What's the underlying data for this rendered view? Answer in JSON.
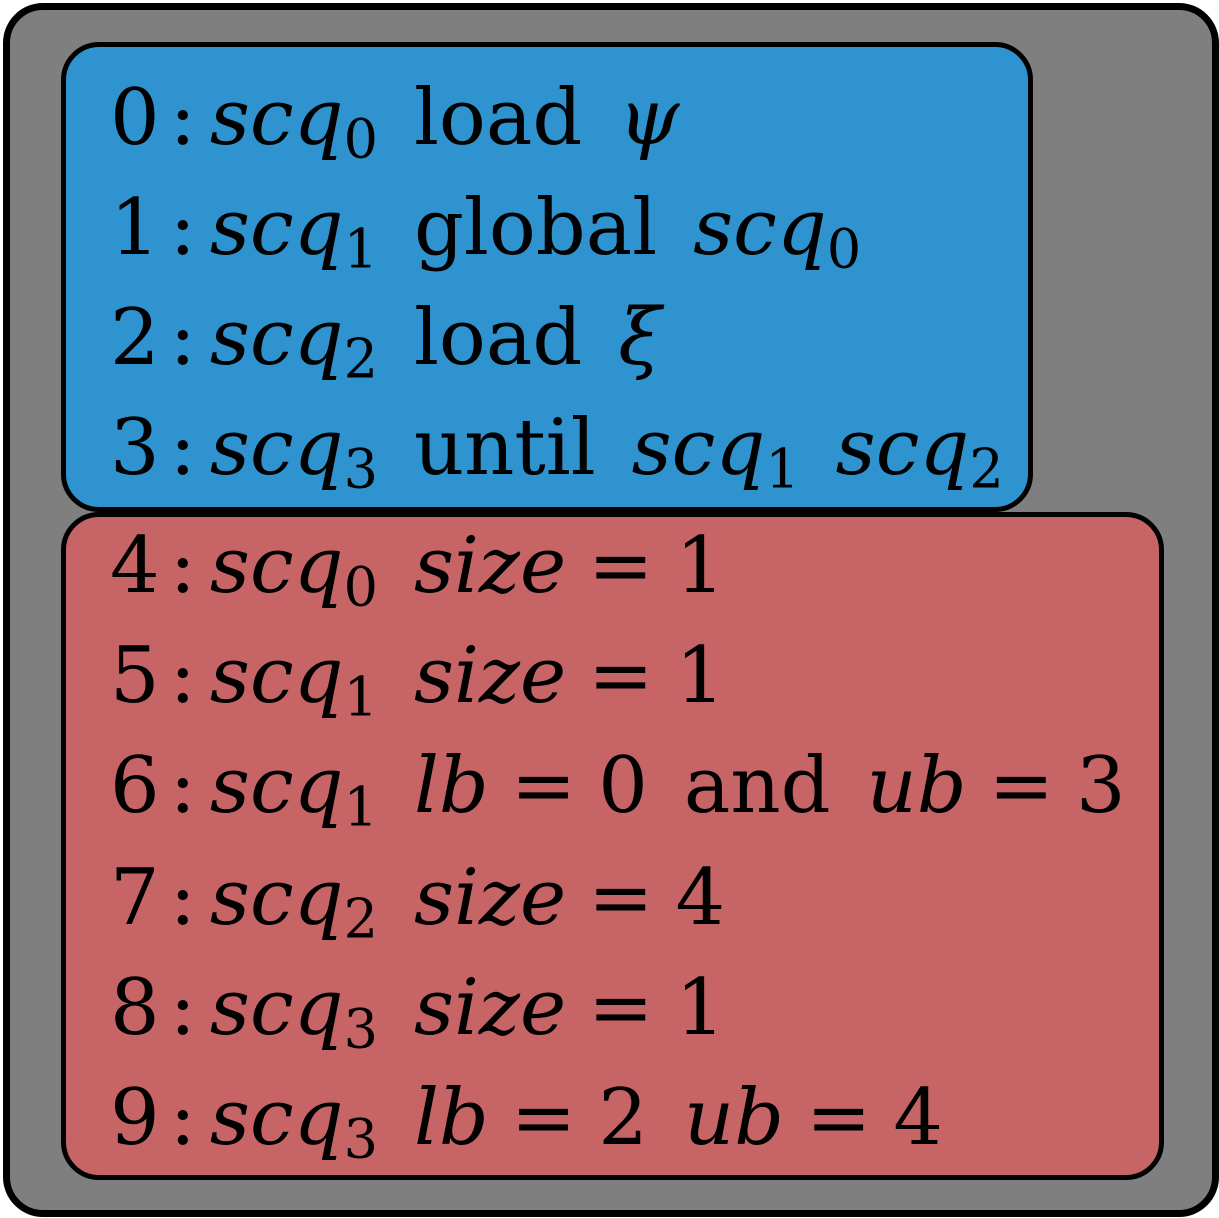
{
  "colors": {
    "outer_background": "#7f7f7f",
    "top_block": "#2e93cf",
    "bottom_block": "#c76566",
    "border": "#000000"
  },
  "lines": [
    {
      "num": "0",
      "var": "scq",
      "sub": "0",
      "tail": [
        {
          "t": "word",
          "v": "load"
        },
        {
          "t": "greek",
          "v": "ψ"
        }
      ]
    },
    {
      "num": "1",
      "var": "scq",
      "sub": "1",
      "tail": [
        {
          "t": "word",
          "v": "global"
        },
        {
          "t": "scq",
          "v": "scq",
          "s": "0"
        }
      ]
    },
    {
      "num": "2",
      "var": "scq",
      "sub": "2",
      "tail": [
        {
          "t": "word",
          "v": "load"
        },
        {
          "t": "greek",
          "v": "ξ"
        }
      ]
    },
    {
      "num": "3",
      "var": "scq",
      "sub": "3",
      "tail": [
        {
          "t": "word",
          "v": "until"
        },
        {
          "t": "scq",
          "v": "scq",
          "s": "1"
        },
        {
          "t": "scq",
          "v": "scq",
          "s": "2"
        }
      ]
    },
    {
      "num": "4",
      "var": "scq",
      "sub": "0",
      "tail": [
        {
          "t": "ivar",
          "v": "size"
        },
        {
          "t": "op",
          "v": "="
        },
        {
          "t": "num",
          "v": "1"
        }
      ]
    },
    {
      "num": "5",
      "var": "scq",
      "sub": "1",
      "tail": [
        {
          "t": "ivar",
          "v": "size"
        },
        {
          "t": "op",
          "v": "="
        },
        {
          "t": "num",
          "v": "1"
        }
      ]
    },
    {
      "num": "6",
      "var": "scq",
      "sub": "1",
      "tail": [
        {
          "t": "ivar",
          "v": "lb"
        },
        {
          "t": "op",
          "v": "="
        },
        {
          "t": "num",
          "v": "0"
        },
        {
          "t": "word",
          "v": "and"
        },
        {
          "t": "ivar",
          "v": "ub"
        },
        {
          "t": "op",
          "v": "="
        },
        {
          "t": "num",
          "v": "3"
        }
      ]
    },
    {
      "num": "7",
      "var": "scq",
      "sub": "2",
      "tail": [
        {
          "t": "ivar",
          "v": "size"
        },
        {
          "t": "op",
          "v": "="
        },
        {
          "t": "num",
          "v": "4"
        }
      ]
    },
    {
      "num": "8",
      "var": "scq",
      "sub": "3",
      "tail": [
        {
          "t": "ivar",
          "v": "size"
        },
        {
          "t": "op",
          "v": "="
        },
        {
          "t": "num",
          "v": "1"
        }
      ]
    },
    {
      "num": "9",
      "var": "scq",
      "sub": "3",
      "tail": [
        {
          "t": "ivar",
          "v": "lb"
        },
        {
          "t": "op",
          "v": "="
        },
        {
          "t": "num",
          "v": "2"
        },
        {
          "t": "ivar",
          "v": "ub"
        },
        {
          "t": "op",
          "v": "="
        },
        {
          "t": "num",
          "v": "4"
        }
      ]
    }
  ]
}
